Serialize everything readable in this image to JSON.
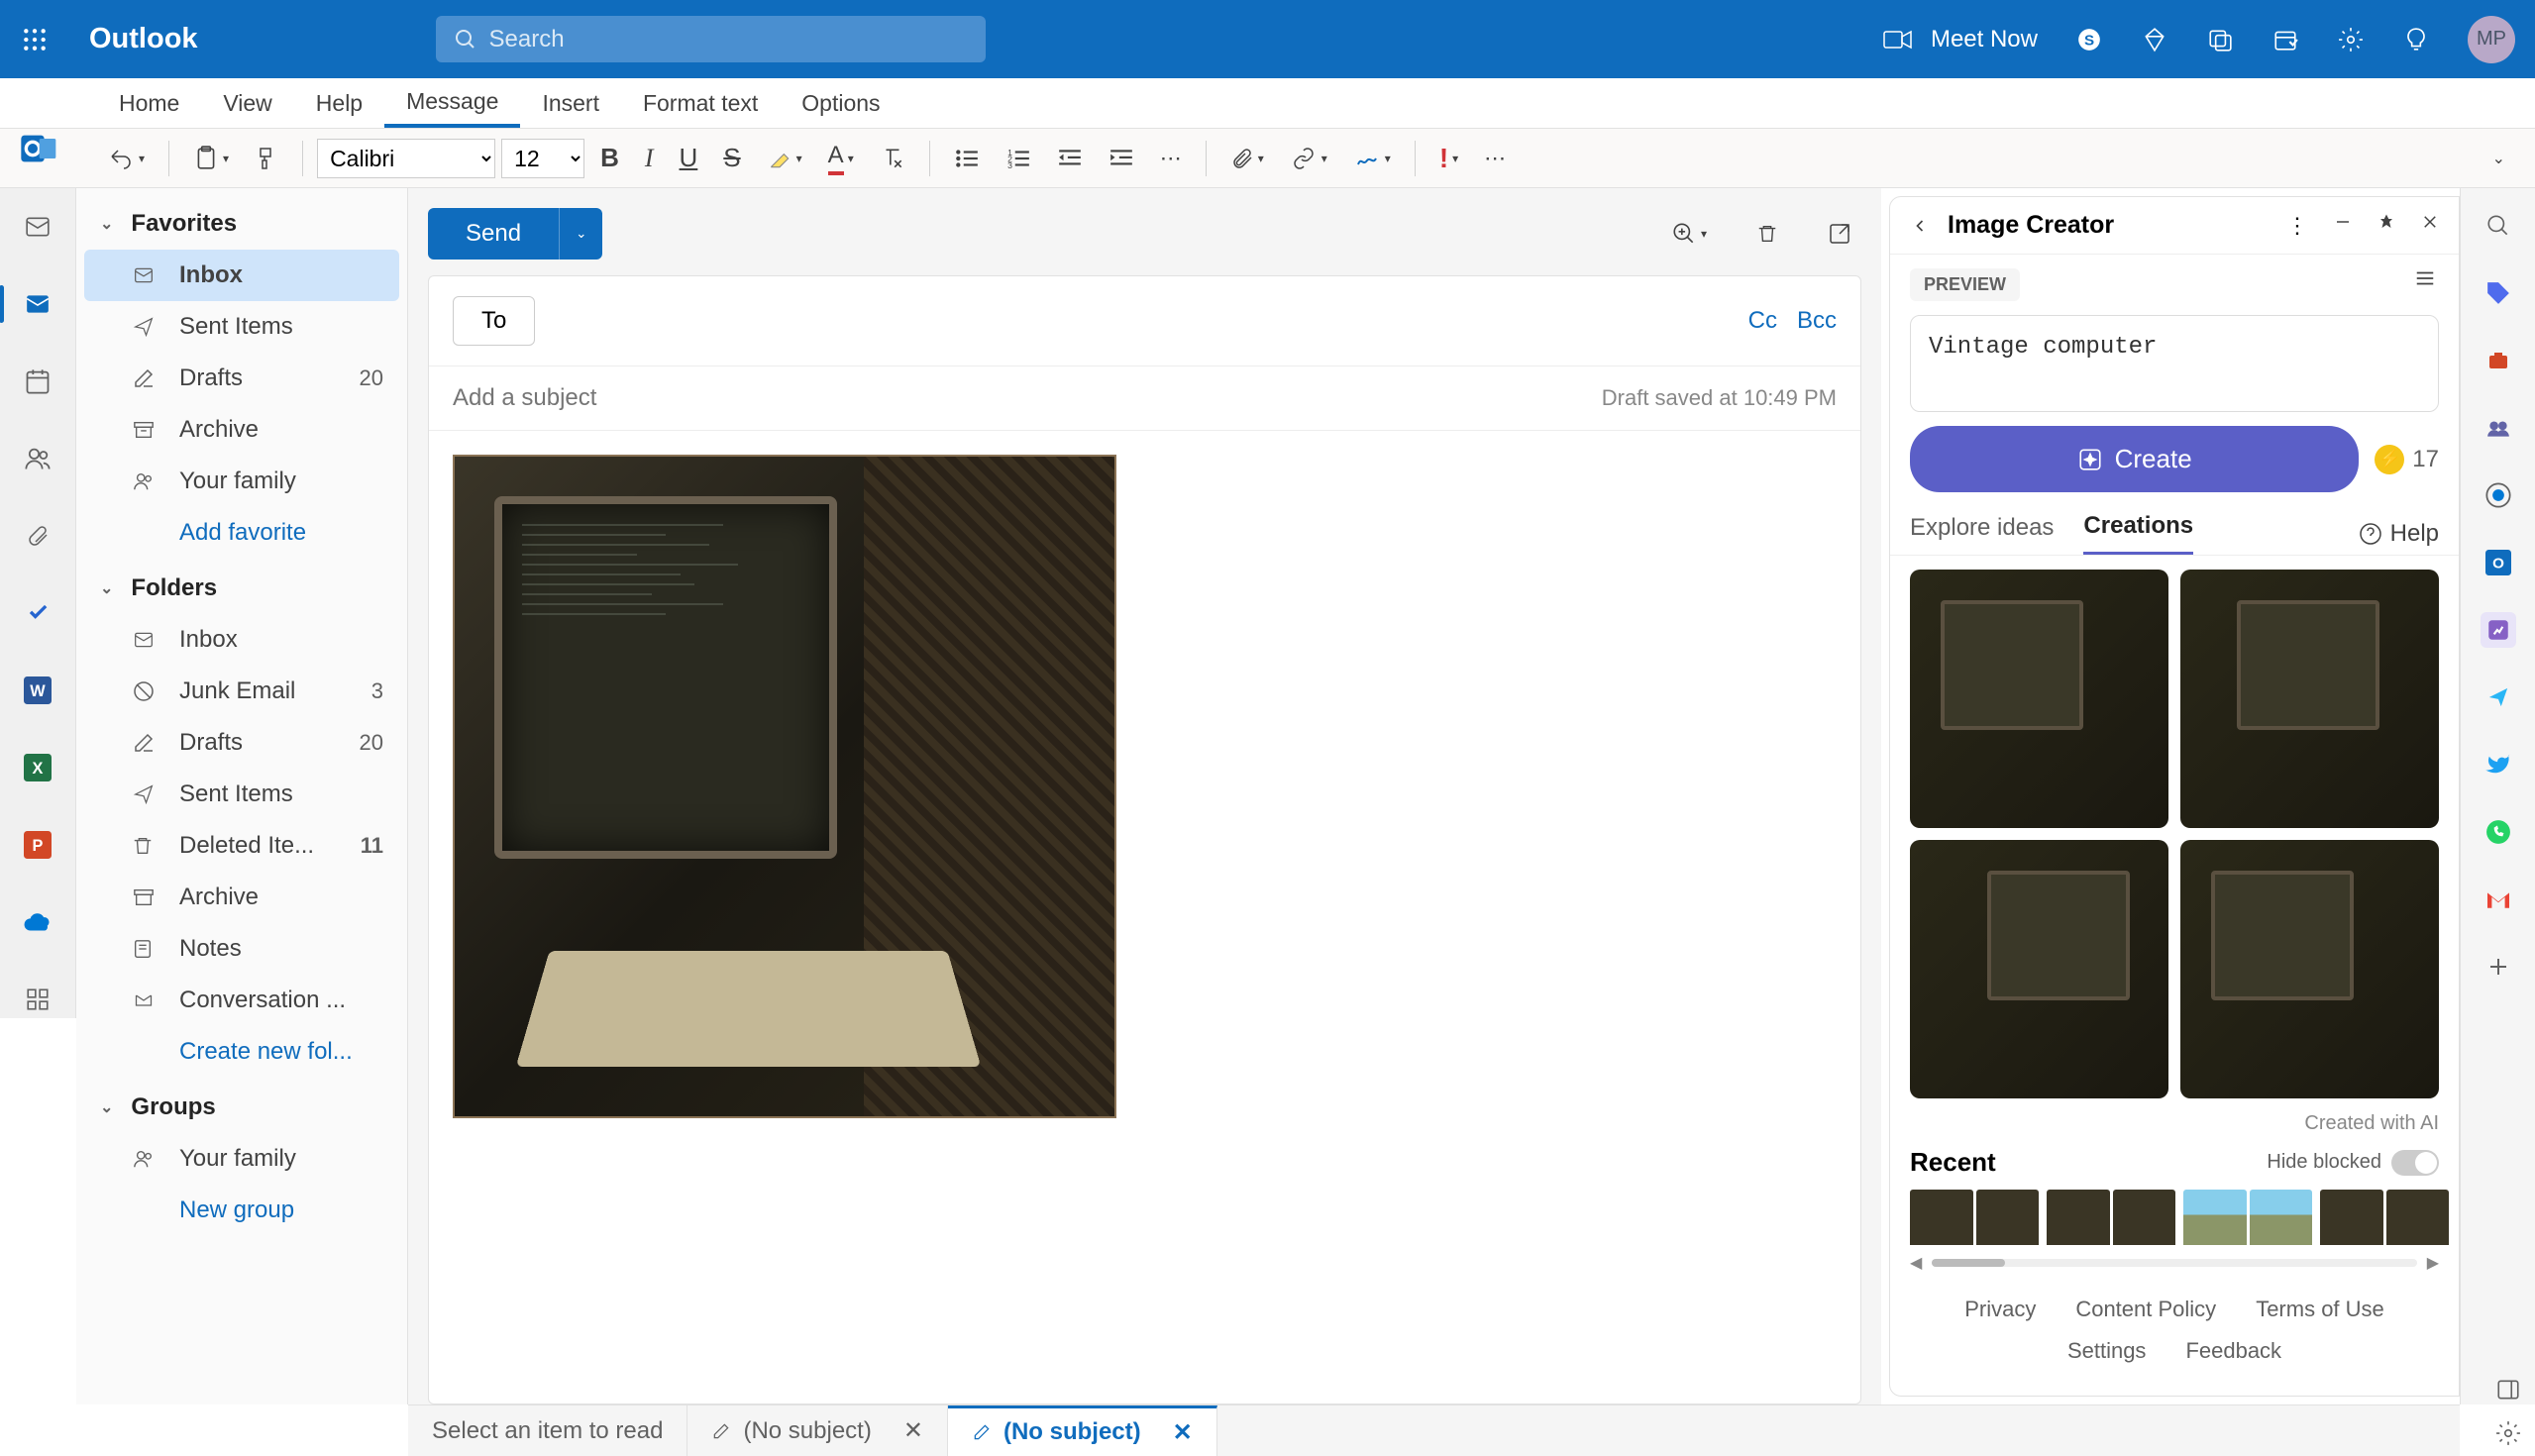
{
  "header": {
    "app_name": "Outlook",
    "search_placeholder": "Search",
    "meet_now": "Meet Now",
    "avatar_initials": "MP"
  },
  "tabs": {
    "items": [
      "Home",
      "View",
      "Help",
      "Message",
      "Insert",
      "Format text",
      "Options"
    ],
    "active": 3
  },
  "toolbar": {
    "font_name": "Calibri",
    "font_size": "12"
  },
  "folder_pane": {
    "favorites": {
      "title": "Favorites",
      "items": [
        {
          "label": "Inbox",
          "count": "",
          "selected": true
        },
        {
          "label": "Sent Items",
          "count": ""
        },
        {
          "label": "Drafts",
          "count": "20"
        },
        {
          "label": "Archive",
          "count": ""
        },
        {
          "label": "Your family",
          "count": ""
        }
      ],
      "add_label": "Add favorite"
    },
    "folders": {
      "title": "Folders",
      "items": [
        {
          "label": "Inbox",
          "count": ""
        },
        {
          "label": "Junk Email",
          "count": "3"
        },
        {
          "label": "Drafts",
          "count": "20"
        },
        {
          "label": "Sent Items",
          "count": ""
        },
        {
          "label": "Deleted Ite...",
          "count": "11"
        },
        {
          "label": "Archive",
          "count": ""
        },
        {
          "label": "Notes",
          "count": ""
        },
        {
          "label": "Conversation ...",
          "count": ""
        }
      ],
      "create_label": "Create new fol..."
    },
    "groups": {
      "title": "Groups",
      "items": [
        {
          "label": "Your family",
          "count": ""
        }
      ],
      "new_label": "New group"
    }
  },
  "compose": {
    "send_label": "Send",
    "to_label": "To",
    "cc_label": "Cc",
    "bcc_label": "Bcc",
    "subject_placeholder": "Add a subject",
    "draft_status": "Draft saved at 10:49 PM"
  },
  "bottom_tabs": {
    "reading_label": "Select an item to read",
    "draft1": "(No subject)",
    "draft2": "(No subject)"
  },
  "image_creator": {
    "title": "Image Creator",
    "preview_tag": "PREVIEW",
    "prompt": "Vintage computer",
    "create_label": "Create",
    "credits": "17",
    "tab_explore": "Explore ideas",
    "tab_creations": "Creations",
    "help_label": "Help",
    "created_with": "Created with AI",
    "recent_title": "Recent",
    "hide_blocked": "Hide blocked",
    "links": {
      "privacy": "Privacy",
      "content_policy": "Content Policy",
      "terms": "Terms of Use",
      "settings": "Settings",
      "feedback": "Feedback"
    }
  }
}
